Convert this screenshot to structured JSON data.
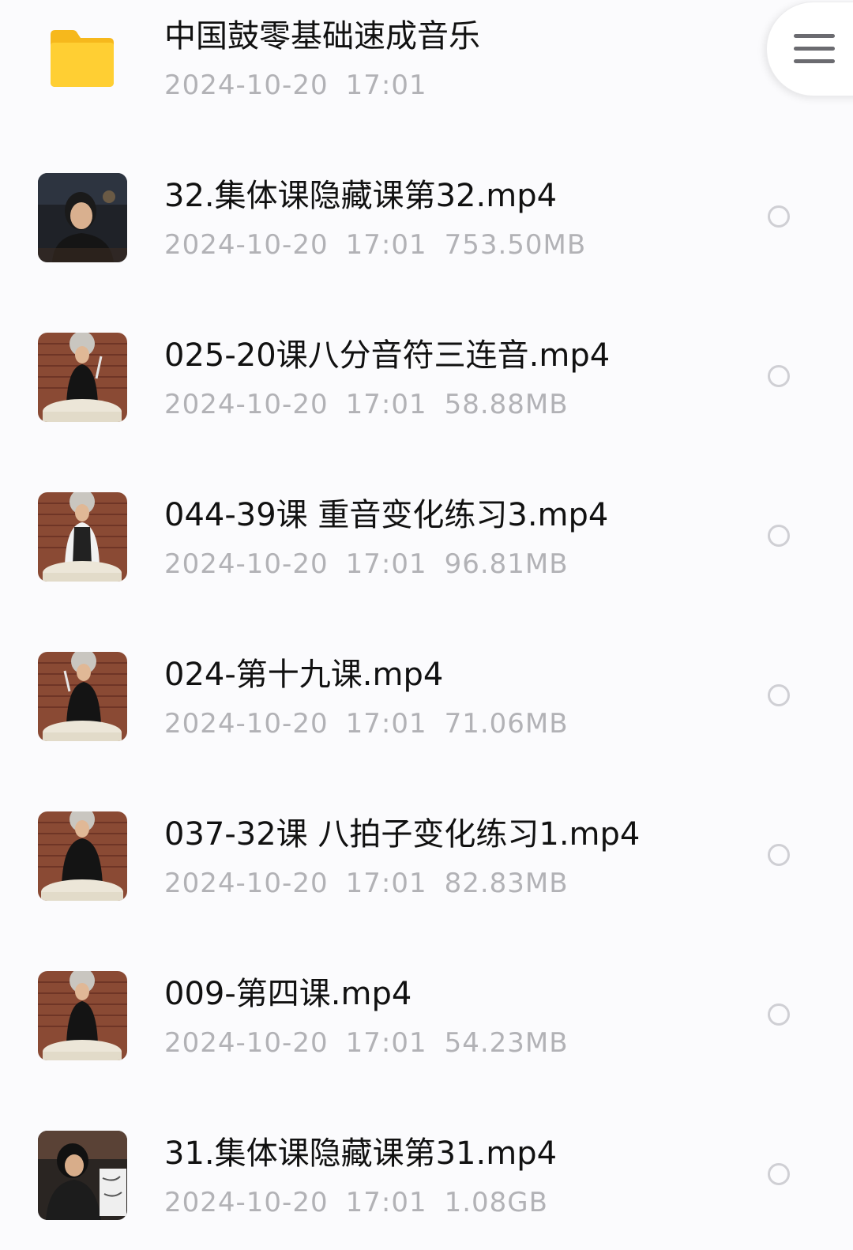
{
  "folder": {
    "name": "中国鼓零基础速成音乐",
    "date": "2024-10-20",
    "time": "17:01",
    "icon": "folder-icon",
    "color": "#ffc928"
  },
  "menu": {
    "icon": "hamburger-menu-icon"
  },
  "files": [
    {
      "name": "32.集体课隐藏课第32.mp4",
      "date": "2024-10-20",
      "time": "17:01",
      "size": "753.50MB"
    },
    {
      "name": "025-20课八分音符三连音.mp4",
      "date": "2024-10-20",
      "time": "17:01",
      "size": "58.88MB"
    },
    {
      "name": "044-39课 重音变化练习3.mp4",
      "date": "2024-10-20",
      "time": "17:01",
      "size": "96.81MB"
    },
    {
      "name": "024-第十九课.mp4",
      "date": "2024-10-20",
      "time": "17:01",
      "size": "71.06MB"
    },
    {
      "name": "037-32课 八拍子变化练习1.mp4",
      "date": "2024-10-20",
      "time": "17:01",
      "size": "82.83MB"
    },
    {
      "name": "009-第四课.mp4",
      "date": "2024-10-20",
      "time": "17:01",
      "size": "54.23MB"
    },
    {
      "name": "31.集体课隐藏课第31.mp4",
      "date": "2024-10-20",
      "time": "17:01",
      "size": "1.08GB"
    }
  ]
}
